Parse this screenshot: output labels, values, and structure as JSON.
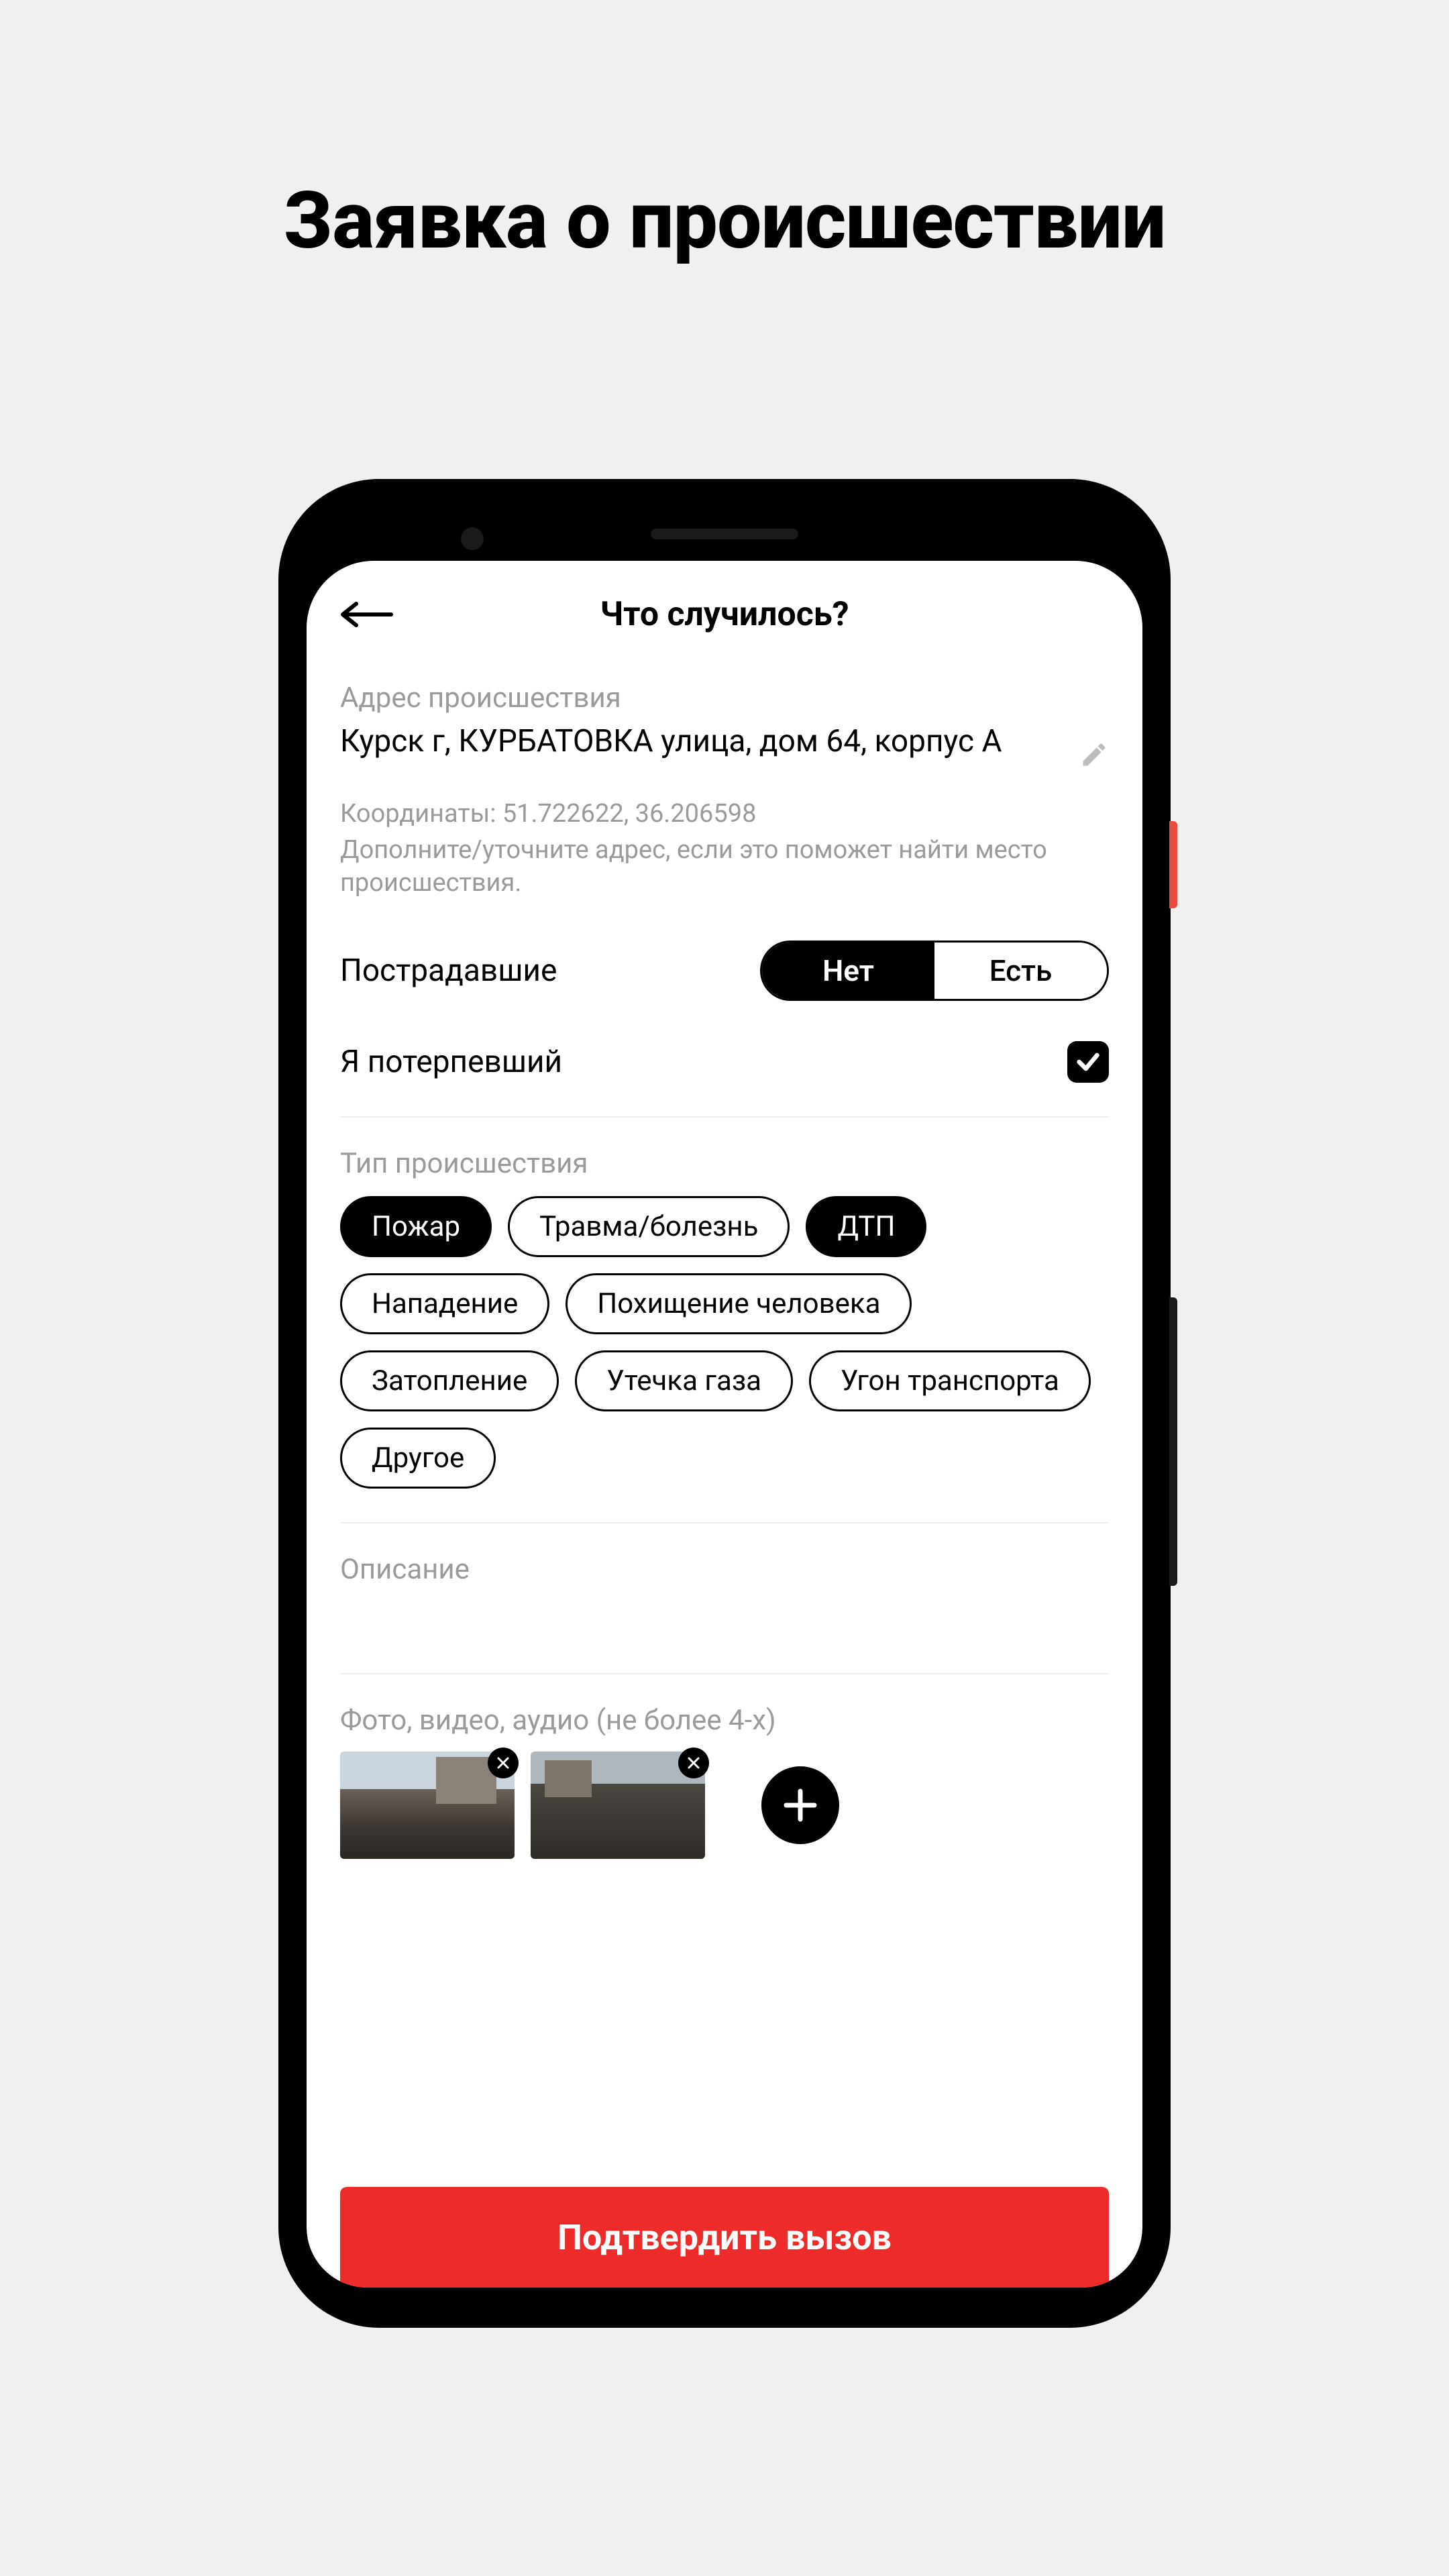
{
  "page_heading": "Заявка о происшествии",
  "header": {
    "title": "Что случилось?"
  },
  "address": {
    "label": "Адрес происшествия",
    "value": "Курск г, КУРБАТОВКА улица, дом 64, корпус А",
    "coordinates": "Координаты: 51.722622, 36.206598",
    "hint": "Дополните/уточните адрес, если это поможет найти место происшествия."
  },
  "victims": {
    "label": "Пострадавшие",
    "option_no": "Нет",
    "option_yes": "Есть",
    "selected": "no"
  },
  "self_victim": {
    "label": "Я потерпевший",
    "checked": true
  },
  "incident_type": {
    "label": "Тип происшествия",
    "options": [
      {
        "label": "Пожар",
        "active": true
      },
      {
        "label": "Травма/болезнь",
        "active": false
      },
      {
        "label": "ДТП",
        "active": true
      },
      {
        "label": "Нападение",
        "active": false
      },
      {
        "label": "Похищение человека",
        "active": false
      },
      {
        "label": "Затопление",
        "active": false
      },
      {
        "label": "Утечка газа",
        "active": false
      },
      {
        "label": "Угон транспорта",
        "active": false
      },
      {
        "label": "Другое",
        "active": false
      }
    ]
  },
  "description": {
    "label": "Описание"
  },
  "media": {
    "label": "Фото, видео, аудио (не более 4-х)",
    "count": 2
  },
  "confirm": {
    "label": "Подтвердить вызов"
  }
}
